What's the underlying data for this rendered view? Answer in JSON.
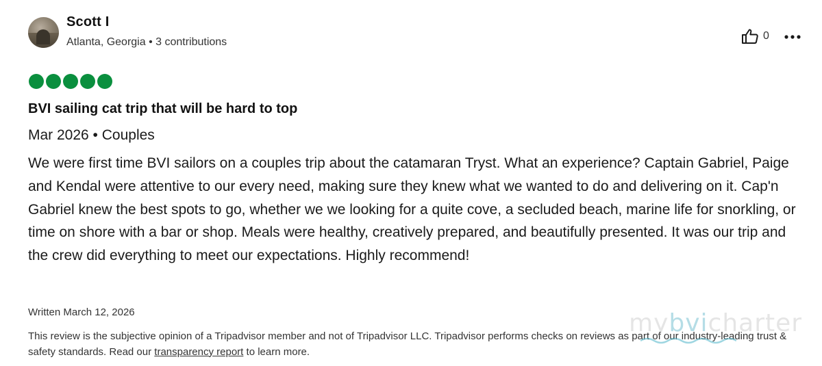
{
  "author": {
    "name": "Scott I",
    "meta": "Atlanta, Georgia • 3 contributions",
    "avatar_icon": "profile-photo"
  },
  "actions": {
    "helpful_icon": "thumbs-up-icon",
    "helpful_count": "0",
    "more_icon": "more-horizontal-icon"
  },
  "review": {
    "rating": 5,
    "rating_max": 5,
    "rating_color": "#0a8f3e",
    "title": "BVI sailing cat trip that will be hard to top",
    "meta": "Mar 2026 • Couples",
    "body": "We were first time BVI sailors on a couples trip about the catamaran Tryst. What an experience? Captain Gabriel, Paige and Kendal were attentive to our every need, making sure they knew what we wanted to do and delivering on it. Cap'n Gabriel knew the best spots to go, whether we we looking for a quite cove, a secluded beach, marine life for snorkling, or time on shore with a bar or shop. Meals were healthy, creatively prepared, and beautifully presented. It was our trip and the crew did everything to meet our expectations. Highly recommend!",
    "written": "Written March 12, 2026"
  },
  "disclaimer": {
    "text_before": "This review is the subjective opinion of a Tripadvisor member and not of Tripadvisor LLC. Tripadvisor performs checks on reviews as part of our industry-leading trust & safety standards. Read our ",
    "link": "transparency report",
    "text_after": " to learn more."
  },
  "watermark": {
    "left": "my",
    "mid": "bvi",
    "right": "charter"
  }
}
